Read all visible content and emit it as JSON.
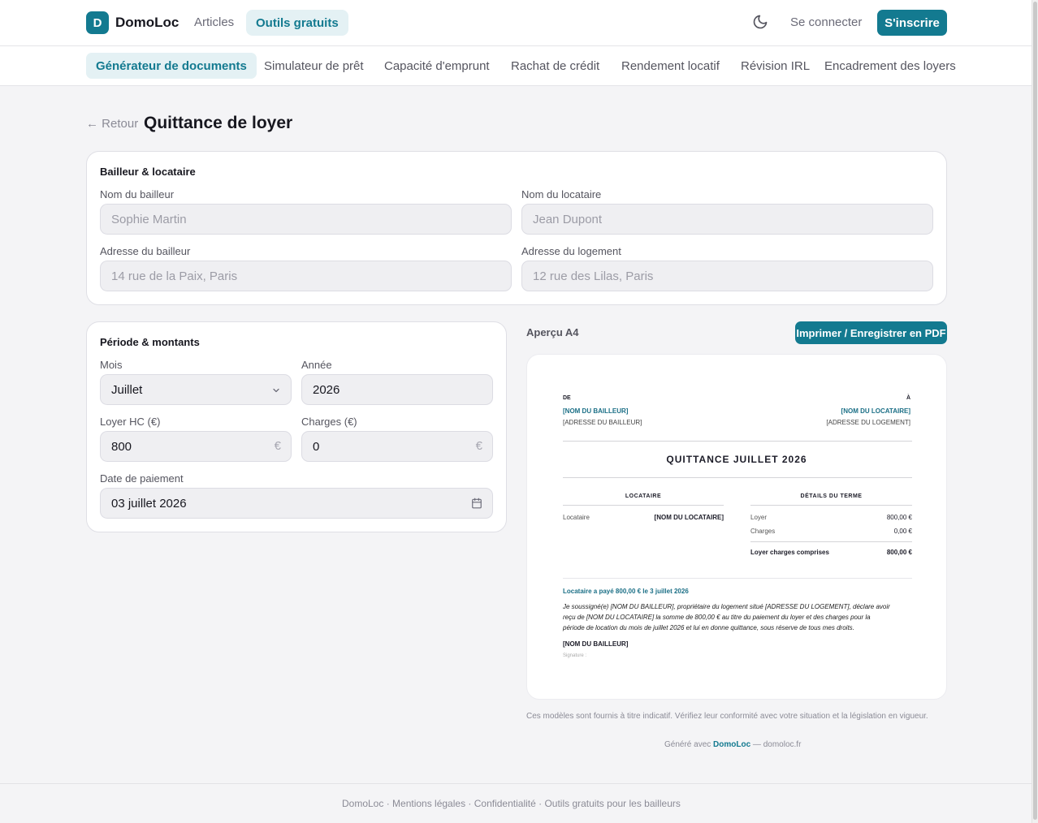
{
  "header": {
    "logo_letter": "D",
    "brand": "DomoLoc",
    "nav": {
      "articles": "Articles",
      "tools": "Outils gratuits"
    },
    "login": "Se connecter",
    "signup": "S'inscrire",
    "theme_icon": "moon-icon"
  },
  "subnav": {
    "items": [
      "Générateur de documents",
      "Simulateur de prêt",
      "Capacité d'emprunt",
      "Rachat de crédit",
      "Rendement locatif",
      "Révision IRL",
      "Encadrement des loyers"
    ],
    "active_index": 0
  },
  "page": {
    "back": "← Retour",
    "title": "Quittance de loyer"
  },
  "parties": {
    "title": "Bailleur & locataire",
    "landlord_name": {
      "label": "Nom du bailleur",
      "placeholder": "Sophie Martin"
    },
    "tenant_name": {
      "label": "Nom du locataire",
      "placeholder": "Jean Dupont"
    },
    "landlord_address": {
      "label": "Adresse du bailleur",
      "placeholder": "14 rue de la Paix, Paris"
    },
    "housing_address": {
      "label": "Adresse du logement",
      "placeholder": "12 rue des Lilas, Paris"
    }
  },
  "period": {
    "title": "Période & montants",
    "month": {
      "label": "Mois",
      "value": "Juillet"
    },
    "year": {
      "label": "Année",
      "value": "2026"
    },
    "rent": {
      "label": "Loyer HC (€)",
      "value": "800",
      "suffix": "€"
    },
    "charges": {
      "label": "Charges (€)",
      "value": "0",
      "suffix": "€"
    },
    "payment_date": {
      "label": "Date de paiement",
      "value": "03 juillet 2026"
    }
  },
  "preview": {
    "label": "Aperçu A4",
    "print_button": "Imprimer / Enregistrer en PDF",
    "doc": {
      "from_label": "DE",
      "to_label": "À",
      "landlord_name": "[NOM DU BAILLEUR]",
      "landlord_address": "[ADRESSE DU BAILLEUR]",
      "tenant_name": "[NOM DU LOCATAIRE]",
      "housing_address": "[ADRESSE DU LOGEMENT]",
      "title": "QUITTANCE JUILLET 2026",
      "col_tenant": "LOCATAIRE",
      "col_details": "DÉTAILS DU TERME",
      "tenant_row_label": "Locataire",
      "tenant_row_value": "[NOM DU LOCATAIRE]",
      "rent_label": "Loyer",
      "rent_value": "800,00 €",
      "charges_label": "Charges",
      "charges_value": "0,00 €",
      "total_label": "Loyer charges comprises",
      "total_value": "800,00 €",
      "paid_line": "Locataire a payé 800,00 € le 3 juillet 2026",
      "body_line1": "Je soussigné(e) [NOM DU BAILLEUR], propriétaire du logement situé [ADRESSE DU LOGEMENT], déclare avoir",
      "body_line2": "reçu de [NOM DU LOCATAIRE] la somme de 800,00 € au titre du paiement du loyer et des charges pour la",
      "body_line3": "période de location du mois de juillet 2026 et lui en donne quittance, sous réserve de tous mes droits.",
      "signer": "[NOM DU BAILLEUR]",
      "signature_label": "Signature :"
    }
  },
  "disclaimer": "Ces modèles sont fournis à titre indicatif. Vérifiez leur conformité avec votre situation et la législation en vigueur.",
  "generated": {
    "prefix": "Généré avec ",
    "brand": "DomoLoc",
    "suffix": " — domoloc.fr"
  },
  "footer": "DomoLoc · Mentions légales · Confidentialité · Outils gratuits pour les bailleurs",
  "colors": {
    "accent": "#137a90",
    "accent_light": "#e4f1f4",
    "page_bg": "#f4f4f6"
  }
}
